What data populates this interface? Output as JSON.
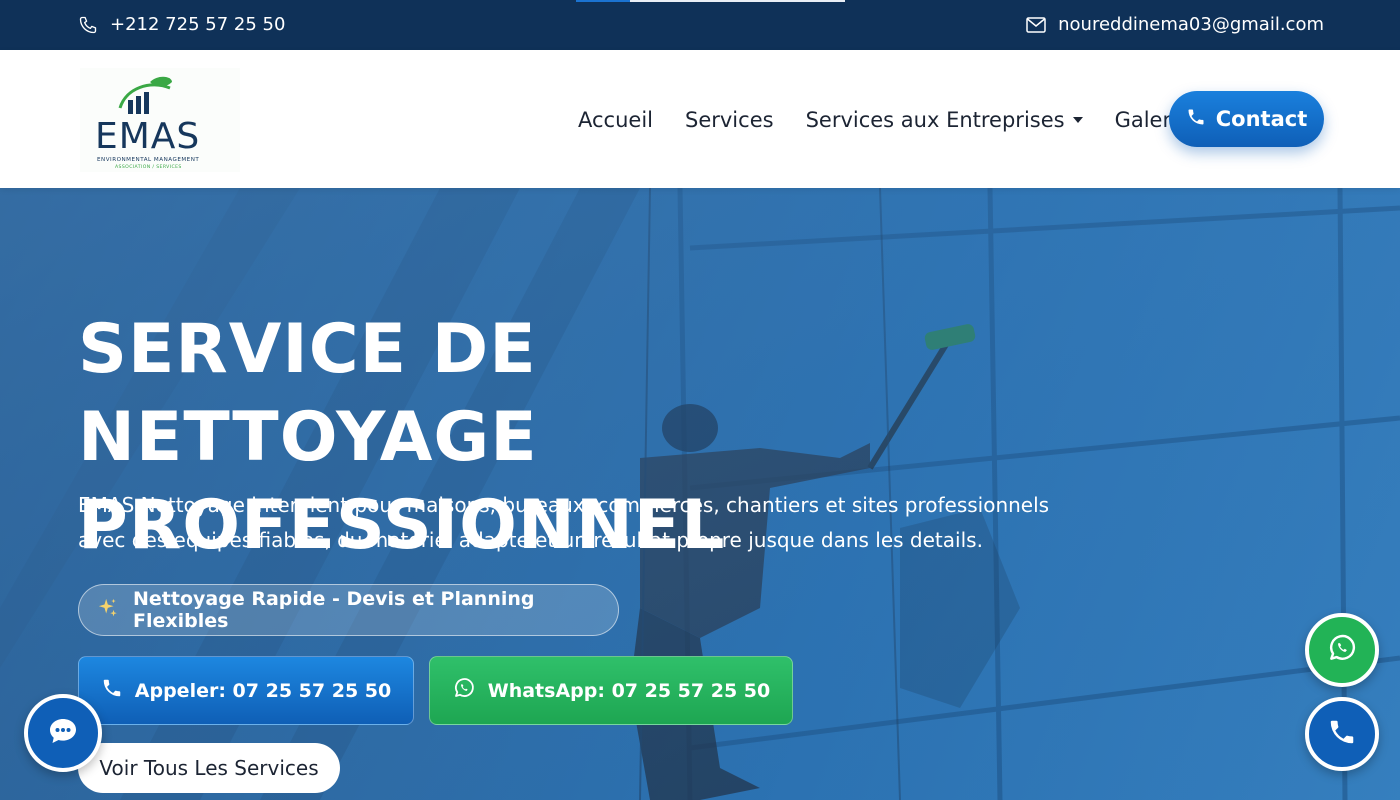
{
  "topbar": {
    "phone": "+212 725 57 25 50",
    "email": "noureddinema03@gmail.com"
  },
  "logo": {
    "brand": "EMAS",
    "tagline": "ENVIRONMENTAL MANAGEMENT",
    "subtagline": "ASSOCIATION / SERVICES"
  },
  "nav": {
    "items": [
      {
        "label": "Accueil"
      },
      {
        "label": "Services"
      },
      {
        "label": "Services aux Entreprises"
      },
      {
        "label": "Galerie"
      }
    ],
    "contact_label": "Contact"
  },
  "hero": {
    "title_line1": "SERVICE DE NETTOYAGE",
    "title_line2": "PROFESSIONNEL",
    "description": "EMAS Nettoyage intervient pour maisons, bureaux, commerces, chantiers et sites professionnels avec des equipes fiables, du materiel adapte et un resultat propre jusque dans les details.",
    "badge": "Nettoyage Rapide - Devis et Planning Flexibles",
    "call_button": "Appeler: 07 25 57 25 50",
    "whatsapp_button": "WhatsApp: 07 25 57 25 50",
    "services_button": "Voir Tous Les Services"
  },
  "icons": {
    "phone": "phone-icon",
    "email": "envelope-icon",
    "sparkle": "sparkles-icon",
    "whatsapp": "whatsapp-icon",
    "chat": "chat-bubble-icon"
  },
  "colors": {
    "topbar": "#0f3158",
    "primary": "#0f5fb7",
    "whatsapp": "#22b356",
    "hero_overlay": "#2f6da6"
  }
}
